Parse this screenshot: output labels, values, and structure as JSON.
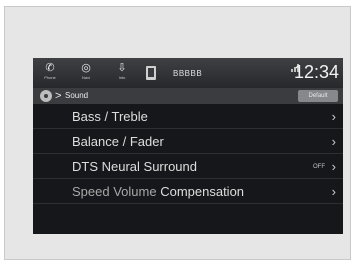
{
  "statusbar": {
    "phone": {
      "icon": "phone-icon",
      "glyph": "✆",
      "label": "Phone"
    },
    "nav": {
      "icon": "nav-icon",
      "glyph": "◎",
      "label": "Navi"
    },
    "info": {
      "icon": "info-icon",
      "glyph": "⇩",
      "label": "Info"
    },
    "device_name": "BBBBB",
    "time": "12:34"
  },
  "breadcrumb": {
    "separator": ">",
    "title": "Sound",
    "default_label": "Default"
  },
  "menu": {
    "items": [
      {
        "label": "Bass / Treble",
        "value": ""
      },
      {
        "label": "Balance / Fader",
        "value": ""
      },
      {
        "label": "DTS Neural Surround",
        "value": "OFF"
      },
      {
        "label_a": "Speed Volume",
        "label_b": "Compensation",
        "value": ""
      }
    ],
    "chevron": "›"
  },
  "colors": {
    "screen_bg": "#15171a",
    "statusbar_bg": "#3e4044",
    "breadcrumb_bg": "#3a3c40",
    "default_button": "#86888c",
    "text": "#dedede"
  }
}
